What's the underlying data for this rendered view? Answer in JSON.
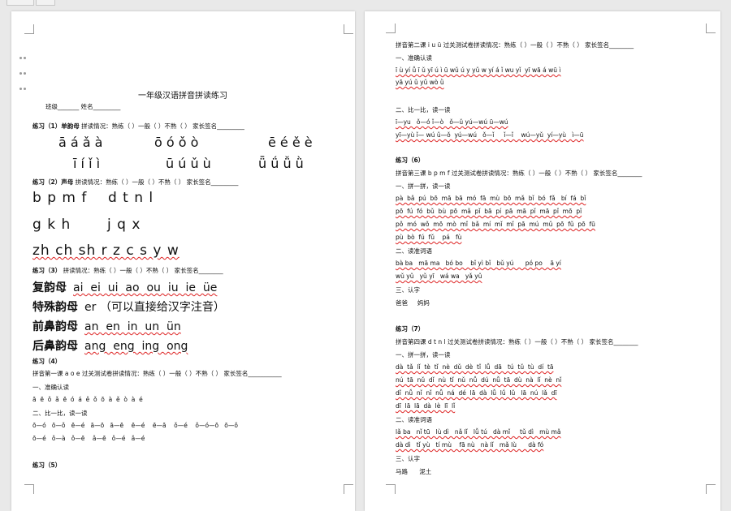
{
  "left": {
    "title": "一年级汉语拼音拼读练习",
    "class_name_line": "班级_______    姓名_________",
    "ex1": {
      "label": "练习（1）单韵母",
      "info": "拼读情况：熟练（ ）一般（ ）不熟（ ）   家长签名_________"
    },
    "tones1": [
      "ā á ǎ à",
      "ō ó ǒ ò",
      "ē é ě è"
    ],
    "tones2": [
      "ī í ǐ ì",
      "ū ú ǔ ù",
      "ǖ ǘ ǚ ǜ"
    ],
    "ex2": {
      "label": "练习（2）声母",
      "info": "拼读情况：熟练（ ）一般（ ）不熟（ ）   家长签名_________"
    },
    "shengmu": [
      "b p m f    d t n l",
      "g k h       j q x",
      "zh ch sh r z c s y w"
    ],
    "ex3": {
      "label": "练习（3）",
      "info": "拼读情况：熟练（ ）一般（ ）不熟（ ）   家长签名________"
    },
    "yunmu": [
      {
        "label": "复韵母",
        "text": "ai  ei  ui  ao  ou  iu  ie  üe"
      },
      {
        "label": "特殊韵母",
        "text": "er （可以直接给汉字注音）"
      },
      {
        "label": "前鼻韵母",
        "text": "an  en  in  un  ün"
      },
      {
        "label": "后鼻韵母",
        "text": "ang  eng  ing  ong"
      }
    ],
    "ex4": "练习（4）",
    "lesson1": "拼音第一课 a o e 过关测试卷拼读情况：熟练（ ）一般（ ）不熟（ ）   家长签名___________",
    "l1_h1": "一、准确认读",
    "l1_r1": "ā  ē  ǒ  ǎ  ē  ó  á  ě  ǒ  ō  à  ě  ò  à  é",
    "l1_h2": "二、比一比，读一读",
    "l1_r2": "ō—ó   ō—ǒ   ē—é   ā—ō   ā—ē    ē—é    ē—ā    ǒ—é    ǒ—ó—ō   ō—ǒ",
    "l1_r3": "ō—é   ǒ—à   ǒ—ē    ǎ—ē   ǒ—é   ǎ—é",
    "ex5": "练习（5）"
  },
  "right": {
    "lesson2": "拼音第二课 i u ü 过关测试卷拼读情况：熟练（ ）一般（ ）不熟（ ）   家长签名________",
    "l2_h1": "一、准确认读",
    "l2_r1": "ī ù yí ǚ ī ǔ yī ú ì ū wǔ ú y yǔ w yí á ǐ wu yǐ  yī wā á wū ì",
    "l2_r2": "yā yú ǔ yǔ wò ǜ",
    "l2_h2": "二、比一比，读一读",
    "l2_r3": "ī—yu   ǒ—ó ǐ—ò   ǒ—ǔ yú—wú ū—wú",
    "l2_r4": "yī—yù ǐ— wú ǔ—ǒ  yú—wú   ǒ—ǐ     ǐ—ǐ    wú—yǔ  yí—yù   ì—ū",
    "ex6": "练习（6）",
    "lesson3": "拼音第三课 b p m f 过关测试卷拼读情况：熟练（ ）一般（ ）不熟（ ）   家长签名________",
    "l3_h1": "一、拼一拼，读一读",
    "l3_rows": [
      "pà  bǎ  pú  bō  mā  bā  mó  fā  mù  bō  mǎ  bǐ  bó  fǎ   bí  fá  bǐ",
      "pō  fú  fó  bǔ  bù  pō  mǎ  pǐ  bā  pí  pā  mā  pǐ  mā  pǐ  mō  pǐ",
      "pǒ  mó  wǒ  mō  mò  mǐ  bǎ  mí  mǐ  mǐ  pā  mú  mǔ  pō  fǔ  pō  fū",
      "pù  bò  fú  fǔ    pá   fù"
    ],
    "l3_h2": "二、读准词语",
    "l3_r5": "bà ba   mā ma   bó bo    bǐ yì bǐ   bǔ yú      pó po    ā yí",
    "l3_r6": "wǔ yǔ   yǔ yī   wá wa   yǎ yǔ",
    "l3_h3": "三、认字",
    "l3_r7": "爸爸     妈妈",
    "ex7": "练习（7）",
    "lesson4": "拼音第四课 d t n l 过关测试卷拼读情况：熟练（ ）一般（ ）不熟（ ）   家长签名________",
    "l4_h1": "一、拼一拼，读一读",
    "l4_rows": [
      "dà  tǎ  lǐ  tè  tǐ  nè  dǔ  dè  tǐ  lǚ  dā   tú  tǔ  tù  dí  tā",
      "nú  tā  nǔ  dǐ  nù  tǐ  nǔ  nǚ  dú  nǚ  tā  dù  nà  lǐ  nè  nǐ",
      "dǐ  nǚ  nǐ  nǐ  nǚ  ná  dé  lā  dà  lǚ  lǘ  lǔ   lā  nú  lǎ  dī",
      "dī  lā  lā  dà  lè  lī  lǐ"
    ],
    "l4_h2": "二、读准词语",
    "l4_r5": "lǎ ba   nǐ tū   lù dì   nǎ lǐ   lǚ tú   dà mǐ     tǔ dì   mù mǎ",
    "l4_r6": "dà dì   tǐ yù   tí mù    fā nù   nà lǐ   mǎ lù      dà fó",
    "l4_h3": "三、认字",
    "l4_r7": "马路      泥土"
  }
}
